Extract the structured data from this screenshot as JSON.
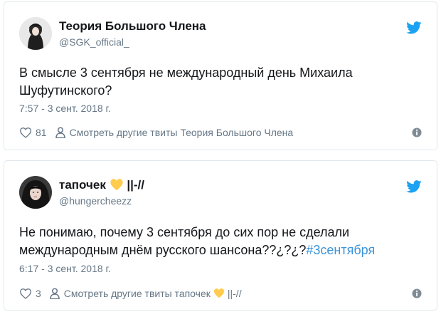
{
  "tweets": [
    {
      "display_name": "Теория Большого Члена",
      "handle": "@SGK_official_",
      "text": "В смысле 3 сентября не международный день Михаила Шуфутинского?",
      "timestamp": "7:57 - 3 сент. 2018 г.",
      "likes": "81",
      "more_tweets_label": "Смотреть другие твиты Теория Большого Члена"
    },
    {
      "display_name_before": "тапочек",
      "display_name_after": "||-//",
      "handle": "@hungercheezz",
      "text": "Не понимаю, почему 3 сентября до сих пор не сделали международным днём русского шансона??¿?¿?",
      "hashtag": "#3сентября",
      "timestamp": "6:17 - 3 сент. 2018 г.",
      "likes": "3",
      "more_tweets_label_before": "Смотреть другие твиты тапочек",
      "more_tweets_label_after": "||-//"
    }
  ],
  "icons": {
    "brand": "twitter-bird-icon",
    "like": "heart-outline-icon",
    "profile": "user-icon",
    "info": "info-icon",
    "emoji": "yellow-heart-emoji"
  },
  "colors": {
    "twitter_blue": "#1da1f2",
    "secondary_text": "#657786",
    "hashtag": "#3b94d9",
    "border": "#e1e8ed",
    "emoji_yellow": "#ffcc4d"
  }
}
